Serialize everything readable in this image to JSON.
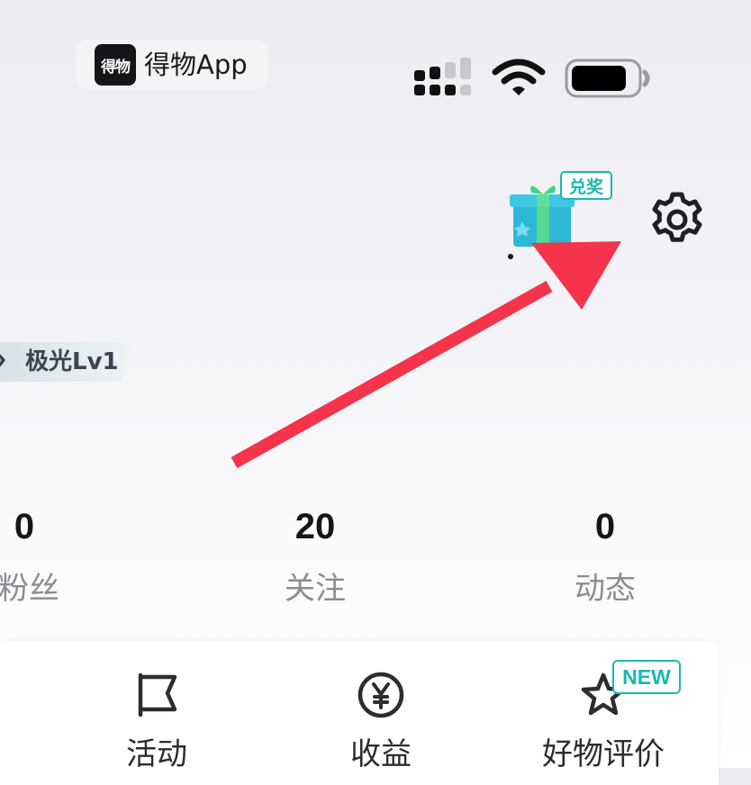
{
  "status_bar": {
    "app_logo_text": "得物",
    "app_name": "得物App"
  },
  "header": {
    "redeem_badge": "兑奖",
    "settings_icon": "gear-icon"
  },
  "profile": {
    "level": "极光Lv1"
  },
  "stats": [
    {
      "value": "0",
      "label": "粉丝"
    },
    {
      "value": "20",
      "label": "关注"
    },
    {
      "value": "0",
      "label": "动态"
    }
  ],
  "menu": [
    {
      "label": "活动",
      "icon": "flag-icon"
    },
    {
      "label": "收益",
      "icon": "yen-coin-icon"
    },
    {
      "label": "好物评价",
      "icon": "star-icon",
      "badge": "NEW"
    }
  ],
  "annotation": {
    "arrow_color": "#f5334a"
  },
  "colors": {
    "accent": "#19b8b0",
    "text_primary": "#16161a",
    "text_secondary": "#8c8c92"
  }
}
